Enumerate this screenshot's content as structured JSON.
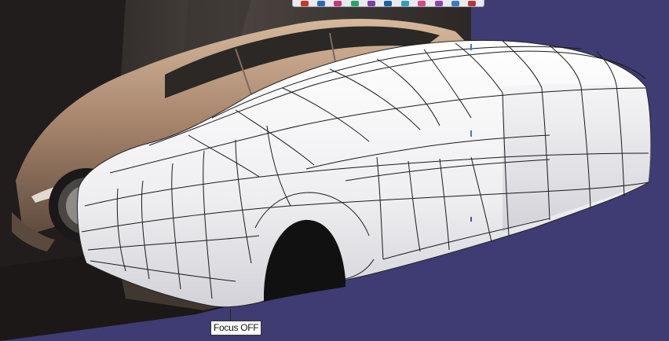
{
  "viewport": {
    "background_color": "#3e3c72",
    "reference_image_description_hidden": true,
    "focus_label": "Focus OFF"
  },
  "toolbar": {
    "icons": [
      {
        "name": "render-icon",
        "color": "#c0392b"
      },
      {
        "name": "sphere-icon",
        "color": "#2b6cb0"
      },
      {
        "name": "material-icon",
        "color": "#c23a7a"
      },
      {
        "name": "light-icon",
        "color": "#27a36a"
      },
      {
        "name": "camera-icon",
        "color": "#7b3fa0"
      },
      {
        "name": "scene-icon",
        "color": "#1f5f9e"
      },
      {
        "name": "environment-icon",
        "color": "#2fa0b0"
      },
      {
        "name": "turntable-icon",
        "color": "#d44a8a"
      },
      {
        "name": "shading-icon",
        "color": "#8e44ad"
      },
      {
        "name": "settings-icon",
        "color": "#3c7ac0"
      },
      {
        "name": "close-icon",
        "color": "#b03a3a"
      }
    ]
  },
  "colors": {
    "model_surface": "#f4f4f6",
    "mesh_lines": "#1a1a1a",
    "photo_background": "#2a2624",
    "photo_car_body": "#b79477"
  }
}
